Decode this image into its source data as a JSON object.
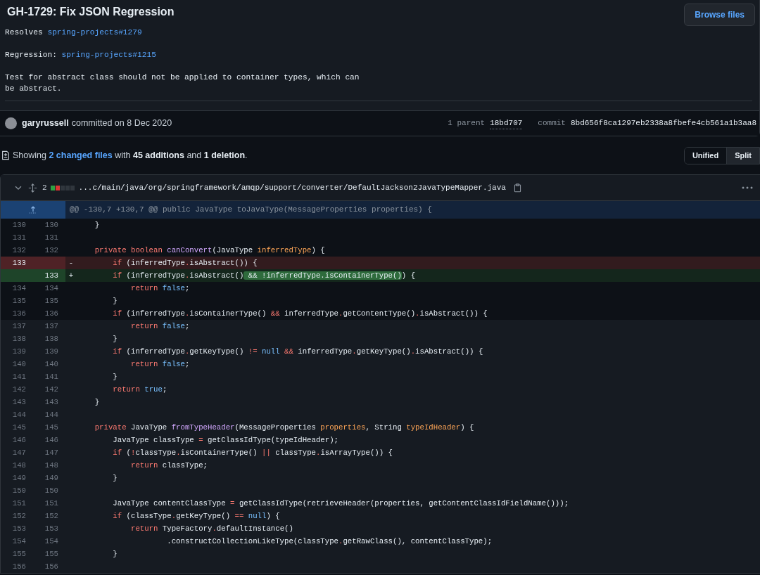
{
  "commit": {
    "title": "GH-1729: Fix JSON Regression",
    "browse_button": "Browse files",
    "message": [
      {
        "parts": [
          {
            "text": "Resolves",
            "kind": "text"
          },
          {
            "text": "spring-projects#1279",
            "kind": "link"
          }
        ]
      },
      {
        "parts": [
          {
            "text": "Regression:",
            "kind": "text"
          },
          {
            "text": "spring-projects#1215",
            "kind": "link"
          }
        ]
      },
      {
        "parts": [
          {
            "text": "Test for abstract class should not be applied to container types, which can be abstract.",
            "kind": "text"
          }
        ]
      }
    ],
    "author": "garyrussell",
    "committed": "committed on 8 Dec 2020",
    "parent_label": "1 parent",
    "parent": "18bd707",
    "commit_label": "commit",
    "sha": "8bd656f8ca1297eb2338a8fbefe4cb561a1b3aa8"
  },
  "summary": {
    "showing": "Showing",
    "changed": "2 changed files",
    "with": "with",
    "additions": "45 additions",
    "and": "and",
    "deletions": "1 deletion",
    "end": "."
  },
  "view_toggle": [
    {
      "label": "Unified",
      "selected": true
    },
    {
      "label": "Split",
      "selected": false
    }
  ],
  "file": {
    "count": "2",
    "stat": [
      {
        "color": "#2ea043"
      },
      {
        "color": "#da3633"
      },
      {
        "color": "#30363d"
      },
      {
        "color": "#30363d"
      },
      {
        "color": "#30363d"
      }
    ],
    "path": "...c/main/java/org/springframework/amqp/support/converter/DefaultJackson2JavaTypeMapper.java",
    "hunk": "@@ -130,7 +130,7 @@ public JavaType toJavaType(MessageProperties properties) {",
    "lines": [
      {
        "kind": "context",
        "old": "130",
        "new": "130",
        "code": [
          {
            "text": "    }",
            "kind": "plain"
          }
        ]
      },
      {
        "kind": "context",
        "old": "131",
        "new": "131"
      },
      {
        "kind": "context",
        "old": "132",
        "new": "132",
        "code": [
          {
            "text": "    private boolean ",
            "kind": "kw"
          },
          {
            "text": "canConvert",
            "kind": "fn"
          },
          {
            "text": "(JavaType ",
            "kind": "plain"
          },
          {
            "text": "inferredType",
            "kind": "param"
          },
          {
            "text": ") {",
            "kind": "plain"
          }
        ]
      },
      {
        "kind": "deletion",
        "old": "133",
        "marker": "-",
        "code": [
          {
            "text": "        if",
            "kind": "kw"
          },
          {
            "text": " (inferredType",
            "kind": "plain"
          },
          {
            "text": ".",
            "kind": "op"
          },
          {
            "text": "isAbstract()) {",
            "kind": "plain"
          }
        ]
      },
      {
        "kind": "addition",
        "new": "133",
        "marker": "+",
        "code": [
          {
            "text": "        if",
            "kind": "kw"
          },
          {
            "text": " (inferredType",
            "kind": "plain"
          },
          {
            "text": ".",
            "kind": "op"
          },
          {
            "text": "isAbstract()",
            "kind": "plain"
          },
          {
            "text": " && !inferredType.isContainerType()",
            "kind": "hl"
          },
          {
            "text": ") {",
            "kind": "plain"
          }
        ]
      },
      {
        "kind": "context",
        "old": "134",
        "new": "134",
        "code": [
          {
            "text": "            return ",
            "kind": "kw"
          },
          {
            "text": "false",
            "kind": "const"
          },
          {
            "text": ";",
            "kind": "plain"
          }
        ]
      },
      {
        "kind": "context",
        "old": "135",
        "new": "135",
        "code": [
          {
            "text": "        }",
            "kind": "plain"
          }
        ]
      },
      {
        "kind": "context",
        "old": "136",
        "new": "136",
        "code": [
          {
            "text": "        if",
            "kind": "kw"
          },
          {
            "text": " (inferredType",
            "kind": "plain"
          },
          {
            "text": ".",
            "kind": "op"
          },
          {
            "text": "isContainerType() ",
            "kind": "plain"
          },
          {
            "text": "&&",
            "kind": "op"
          },
          {
            "text": " inferredType",
            "kind": "plain"
          },
          {
            "text": ".",
            "kind": "op"
          },
          {
            "text": "getContentType()",
            "kind": "plain"
          },
          {
            "text": ".",
            "kind": "op"
          },
          {
            "text": "isAbstract()) {",
            "kind": "plain"
          }
        ]
      },
      {
        "kind": "expanded",
        "old": "137",
        "new": "137",
        "code": [
          {
            "text": "            return ",
            "kind": "kw"
          },
          {
            "text": "false",
            "kind": "const"
          },
          {
            "text": ";",
            "kind": "plain"
          }
        ]
      },
      {
        "kind": "expanded",
        "old": "138",
        "new": "138",
        "code": [
          {
            "text": "        }",
            "kind": "plain"
          }
        ]
      },
      {
        "kind": "expanded",
        "old": "139",
        "new": "139",
        "code": [
          {
            "text": "        if",
            "kind": "kw"
          },
          {
            "text": " (inferredType",
            "kind": "plain"
          },
          {
            "text": ".",
            "kind": "op"
          },
          {
            "text": "getKeyType() ",
            "kind": "plain"
          },
          {
            "text": "!= ",
            "kind": "op"
          },
          {
            "text": "null ",
            "kind": "const"
          },
          {
            "text": "&&",
            "kind": "op"
          },
          {
            "text": " inferredType",
            "kind": "plain"
          },
          {
            "text": ".",
            "kind": "op"
          },
          {
            "text": "getKeyType()",
            "kind": "plain"
          },
          {
            "text": ".",
            "kind": "op"
          },
          {
            "text": "isAbstract()) {",
            "kind": "plain"
          }
        ]
      },
      {
        "kind": "expanded",
        "old": "140",
        "new": "140",
        "code": [
          {
            "text": "            return ",
            "kind": "kw"
          },
          {
            "text": "false",
            "kind": "const"
          },
          {
            "text": ";",
            "kind": "plain"
          }
        ]
      },
      {
        "kind": "expanded",
        "old": "141",
        "new": "141",
        "code": [
          {
            "text": "        }",
            "kind": "plain"
          }
        ]
      },
      {
        "kind": "expanded",
        "old": "142",
        "new": "142",
        "code": [
          {
            "text": "        return ",
            "kind": "kw"
          },
          {
            "text": "true",
            "kind": "const"
          },
          {
            "text": ";",
            "kind": "plain"
          }
        ]
      },
      {
        "kind": "expanded",
        "old": "143",
        "new": "143",
        "code": [
          {
            "text": "    }",
            "kind": "plain"
          }
        ]
      },
      {
        "kind": "expanded",
        "old": "144",
        "new": "144"
      },
      {
        "kind": "expanded",
        "old": "145",
        "new": "145",
        "code": [
          {
            "text": "    private",
            "kind": "kw"
          },
          {
            "text": " JavaType ",
            "kind": "plain"
          },
          {
            "text": "fromTypeHeader",
            "kind": "fn"
          },
          {
            "text": "(MessageProperties ",
            "kind": "plain"
          },
          {
            "text": "properties",
            "kind": "param"
          },
          {
            "text": ", String ",
            "kind": "plain"
          },
          {
            "text": "typeIdHeader",
            "kind": "param"
          },
          {
            "text": ") {",
            "kind": "plain"
          }
        ]
      },
      {
        "kind": "expanded",
        "old": "146",
        "new": "146",
        "code": [
          {
            "text": "        JavaType classType ",
            "kind": "plain"
          },
          {
            "text": "=",
            "kind": "op"
          },
          {
            "text": " getClassIdType(typeIdHeader);",
            "kind": "plain"
          }
        ]
      },
      {
        "kind": "expanded",
        "old": "147",
        "new": "147",
        "code": [
          {
            "text": "        if",
            "kind": "kw"
          },
          {
            "text": " (",
            "kind": "plain"
          },
          {
            "text": "!",
            "kind": "op"
          },
          {
            "text": "classType",
            "kind": "plain"
          },
          {
            "text": ".",
            "kind": "op"
          },
          {
            "text": "isContainerType() ",
            "kind": "plain"
          },
          {
            "text": "||",
            "kind": "op"
          },
          {
            "text": " classType",
            "kind": "plain"
          },
          {
            "text": ".",
            "kind": "op"
          },
          {
            "text": "isArrayType()) {",
            "kind": "plain"
          }
        ]
      },
      {
        "kind": "expanded",
        "old": "148",
        "new": "148",
        "code": [
          {
            "text": "            return",
            "kind": "kw"
          },
          {
            "text": " classType;",
            "kind": "plain"
          }
        ]
      },
      {
        "kind": "expanded",
        "old": "149",
        "new": "149",
        "code": [
          {
            "text": "        }",
            "kind": "plain"
          }
        ]
      },
      {
        "kind": "expanded",
        "old": "150",
        "new": "150"
      },
      {
        "kind": "expanded",
        "old": "151",
        "new": "151",
        "code": [
          {
            "text": "        JavaType contentClassType ",
            "kind": "plain"
          },
          {
            "text": "=",
            "kind": "op"
          },
          {
            "text": " getClassIdType(retrieveHeader(properties, getContentClassIdFieldName()));",
            "kind": "plain"
          }
        ]
      },
      {
        "kind": "expanded",
        "old": "152",
        "new": "152",
        "code": [
          {
            "text": "        if",
            "kind": "kw"
          },
          {
            "text": " (classType",
            "kind": "plain"
          },
          {
            "text": ".",
            "kind": "op"
          },
          {
            "text": "getKeyType() ",
            "kind": "plain"
          },
          {
            "text": "== ",
            "kind": "op"
          },
          {
            "text": "null",
            "kind": "const"
          },
          {
            "text": ") {",
            "kind": "plain"
          }
        ]
      },
      {
        "kind": "expanded",
        "old": "153",
        "new": "153",
        "code": [
          {
            "text": "            return",
            "kind": "kw"
          },
          {
            "text": " TypeFactory",
            "kind": "plain"
          },
          {
            "text": ".",
            "kind": "op"
          },
          {
            "text": "defaultInstance()",
            "kind": "plain"
          }
        ]
      },
      {
        "kind": "expanded",
        "old": "154",
        "new": "154",
        "code": [
          {
            "text": "                    .constructCollectionLikeType(classType",
            "kind": "plain"
          },
          {
            "text": ".",
            "kind": "op"
          },
          {
            "text": "getRawClass(), contentClassType);",
            "kind": "plain"
          }
        ]
      },
      {
        "kind": "expanded",
        "old": "155",
        "new": "155",
        "code": [
          {
            "text": "        }",
            "kind": "plain"
          }
        ]
      },
      {
        "kind": "expanded",
        "old": "156",
        "new": "156"
      }
    ]
  }
}
